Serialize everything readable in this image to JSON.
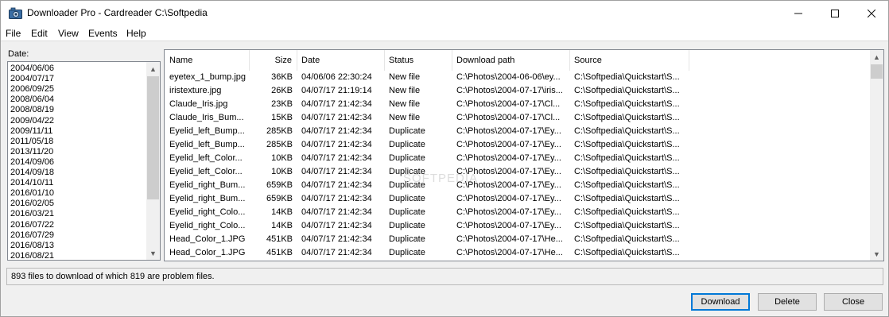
{
  "window": {
    "title": "Downloader Pro - Cardreader C:\\Softpedia"
  },
  "menu": [
    "File",
    "Edit",
    "View",
    "Events",
    "Help"
  ],
  "date_panel": {
    "label": "Date:",
    "dates": [
      "2004/06/06",
      "2004/07/17",
      "2006/09/25",
      "2008/06/04",
      "2008/08/19",
      "2009/04/22",
      "2009/11/11",
      "2011/05/18",
      "2013/11/20",
      "2014/09/06",
      "2014/09/18",
      "2014/10/11",
      "2016/01/10",
      "2016/02/05",
      "2016/03/21",
      "2016/07/22",
      "2016/07/29",
      "2016/08/13",
      "2016/08/21"
    ]
  },
  "table": {
    "columns": [
      "Name",
      "Size",
      "Date",
      "Status",
      "Download path",
      "Source"
    ],
    "rows": [
      {
        "name": "eyetex_1_bump.jpg",
        "size": "36KB",
        "date": "04/06/06 22:30:24",
        "status": "New file",
        "path": "C:\\Photos\\2004-06-06\\ey...",
        "source": "C:\\Softpedia\\Quickstart\\S..."
      },
      {
        "name": "iristexture.jpg",
        "size": "26KB",
        "date": "04/07/17 21:19:14",
        "status": "New file",
        "path": "C:\\Photos\\2004-07-17\\iris...",
        "source": "C:\\Softpedia\\Quickstart\\S..."
      },
      {
        "name": "Claude_Iris.jpg",
        "size": "23KB",
        "date": "04/07/17 21:42:34",
        "status": "New file",
        "path": "C:\\Photos\\2004-07-17\\Cl...",
        "source": "C:\\Softpedia\\Quickstart\\S..."
      },
      {
        "name": "Claude_Iris_Bum...",
        "size": "15KB",
        "date": "04/07/17 21:42:34",
        "status": "New file",
        "path": "C:\\Photos\\2004-07-17\\Cl...",
        "source": "C:\\Softpedia\\Quickstart\\S..."
      },
      {
        "name": "Eyelid_left_Bump...",
        "size": "285KB",
        "date": "04/07/17 21:42:34",
        "status": "Duplicate",
        "path": "C:\\Photos\\2004-07-17\\Ey...",
        "source": "C:\\Softpedia\\Quickstart\\S..."
      },
      {
        "name": "Eyelid_left_Bump...",
        "size": "285KB",
        "date": "04/07/17 21:42:34",
        "status": "Duplicate",
        "path": "C:\\Photos\\2004-07-17\\Ey...",
        "source": "C:\\Softpedia\\Quickstart\\S..."
      },
      {
        "name": "Eyelid_left_Color...",
        "size": "10KB",
        "date": "04/07/17 21:42:34",
        "status": "Duplicate",
        "path": "C:\\Photos\\2004-07-17\\Ey...",
        "source": "C:\\Softpedia\\Quickstart\\S..."
      },
      {
        "name": "Eyelid_left_Color...",
        "size": "10KB",
        "date": "04/07/17 21:42:34",
        "status": "Duplicate",
        "path": "C:\\Photos\\2004-07-17\\Ey...",
        "source": "C:\\Softpedia\\Quickstart\\S..."
      },
      {
        "name": "Eyelid_right_Bum...",
        "size": "659KB",
        "date": "04/07/17 21:42:34",
        "status": "Duplicate",
        "path": "C:\\Photos\\2004-07-17\\Ey...",
        "source": "C:\\Softpedia\\Quickstart\\S..."
      },
      {
        "name": "Eyelid_right_Bum...",
        "size": "659KB",
        "date": "04/07/17 21:42:34",
        "status": "Duplicate",
        "path": "C:\\Photos\\2004-07-17\\Ey...",
        "source": "C:\\Softpedia\\Quickstart\\S..."
      },
      {
        "name": "Eyelid_right_Colo...",
        "size": "14KB",
        "date": "04/07/17 21:42:34",
        "status": "Duplicate",
        "path": "C:\\Photos\\2004-07-17\\Ey...",
        "source": "C:\\Softpedia\\Quickstart\\S..."
      },
      {
        "name": "Eyelid_right_Colo...",
        "size": "14KB",
        "date": "04/07/17 21:42:34",
        "status": "Duplicate",
        "path": "C:\\Photos\\2004-07-17\\Ey...",
        "source": "C:\\Softpedia\\Quickstart\\S..."
      },
      {
        "name": "Head_Color_1.JPG",
        "size": "451KB",
        "date": "04/07/17 21:42:34",
        "status": "Duplicate",
        "path": "C:\\Photos\\2004-07-17\\He...",
        "source": "C:\\Softpedia\\Quickstart\\S..."
      },
      {
        "name": "Head_Color_1.JPG",
        "size": "451KB",
        "date": "04/07/17 21:42:34",
        "status": "Duplicate",
        "path": "C:\\Photos\\2004-07-17\\He...",
        "source": "C:\\Softpedia\\Quickstart\\S..."
      }
    ]
  },
  "watermark": "SOFTPEDIA",
  "status_text": "893 files to download of which 819 are problem files.",
  "buttons": {
    "download": "Download",
    "delete": "Delete",
    "close": "Close"
  },
  "colors": {
    "title_bg": "#ffffff",
    "window_bg": "#f0f0f0",
    "primary_border": "#0078d7"
  }
}
